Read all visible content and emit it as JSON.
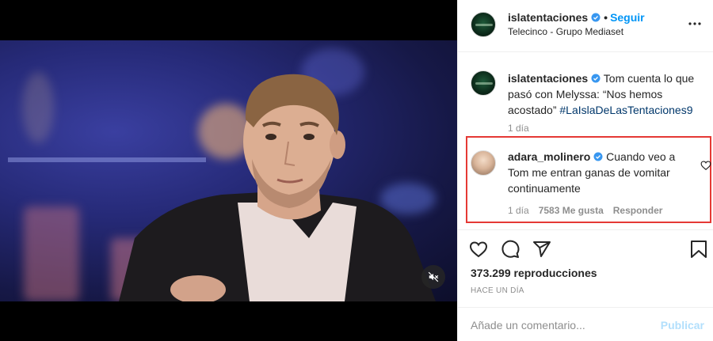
{
  "post": {
    "account": "islatentaciones",
    "follow_label": "Seguir",
    "location": "Telecinco - Grupo Mediaset",
    "caption_text": " Tom cuenta lo que pasó con Melyssa: “Nos hemos acostado” ",
    "caption_hashtag": "#LaIslaDeLasTentaciones9",
    "caption_time": "1 día",
    "views": "373.299 reproducciones",
    "posted": "Hace un día"
  },
  "comment": {
    "user": "adara_molinero",
    "text": " Cuando veo a Tom me entran ganas de vomitar continuamente",
    "time": "1 día",
    "likes": "7583 Me gusta",
    "reply_label": "Responder"
  },
  "composer": {
    "placeholder": "Añade un comentario...",
    "publish_label": "Publicar"
  },
  "icons": [
    "verified-badge-icon",
    "more-options-icon",
    "heart-icon",
    "comment-icon",
    "share-icon",
    "bookmark-icon",
    "muted-speaker-icon"
  ],
  "colors": {
    "accent": "#0095f6",
    "highlight_border": "#e53935",
    "muted_text": "#8e8e8e",
    "hashtag": "#00376b"
  }
}
